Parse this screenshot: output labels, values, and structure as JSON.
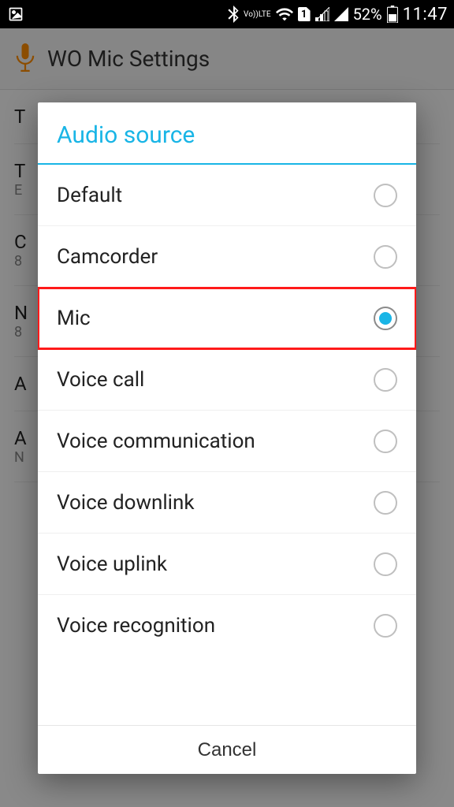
{
  "statusbar": {
    "bluetooth": "bluetooth-icon",
    "lte_top": "Vo))",
    "lte_bot": "LTE",
    "sim_number": "1",
    "battery_percent": "52%",
    "time": "11:47"
  },
  "appbar": {
    "title": "WO Mic Settings"
  },
  "bg_items": [
    {
      "t": "T",
      "s": ""
    },
    {
      "t": "T",
      "s": "E"
    },
    {
      "t": "C",
      "s": "8"
    },
    {
      "t": "N",
      "s": "8"
    },
    {
      "t": "A",
      "s": ""
    },
    {
      "t": "A",
      "s": "N"
    }
  ],
  "dialog": {
    "title": "Audio source",
    "options": [
      {
        "label": "Default",
        "selected": false,
        "highlight": false
      },
      {
        "label": "Camcorder",
        "selected": false,
        "highlight": false
      },
      {
        "label": "Mic",
        "selected": true,
        "highlight": true
      },
      {
        "label": "Voice call",
        "selected": false,
        "highlight": false
      },
      {
        "label": "Voice communication",
        "selected": false,
        "highlight": false
      },
      {
        "label": "Voice downlink",
        "selected": false,
        "highlight": false
      },
      {
        "label": "Voice uplink",
        "selected": false,
        "highlight": false
      },
      {
        "label": "Voice recognition",
        "selected": false,
        "highlight": false
      }
    ],
    "cancel": "Cancel"
  }
}
